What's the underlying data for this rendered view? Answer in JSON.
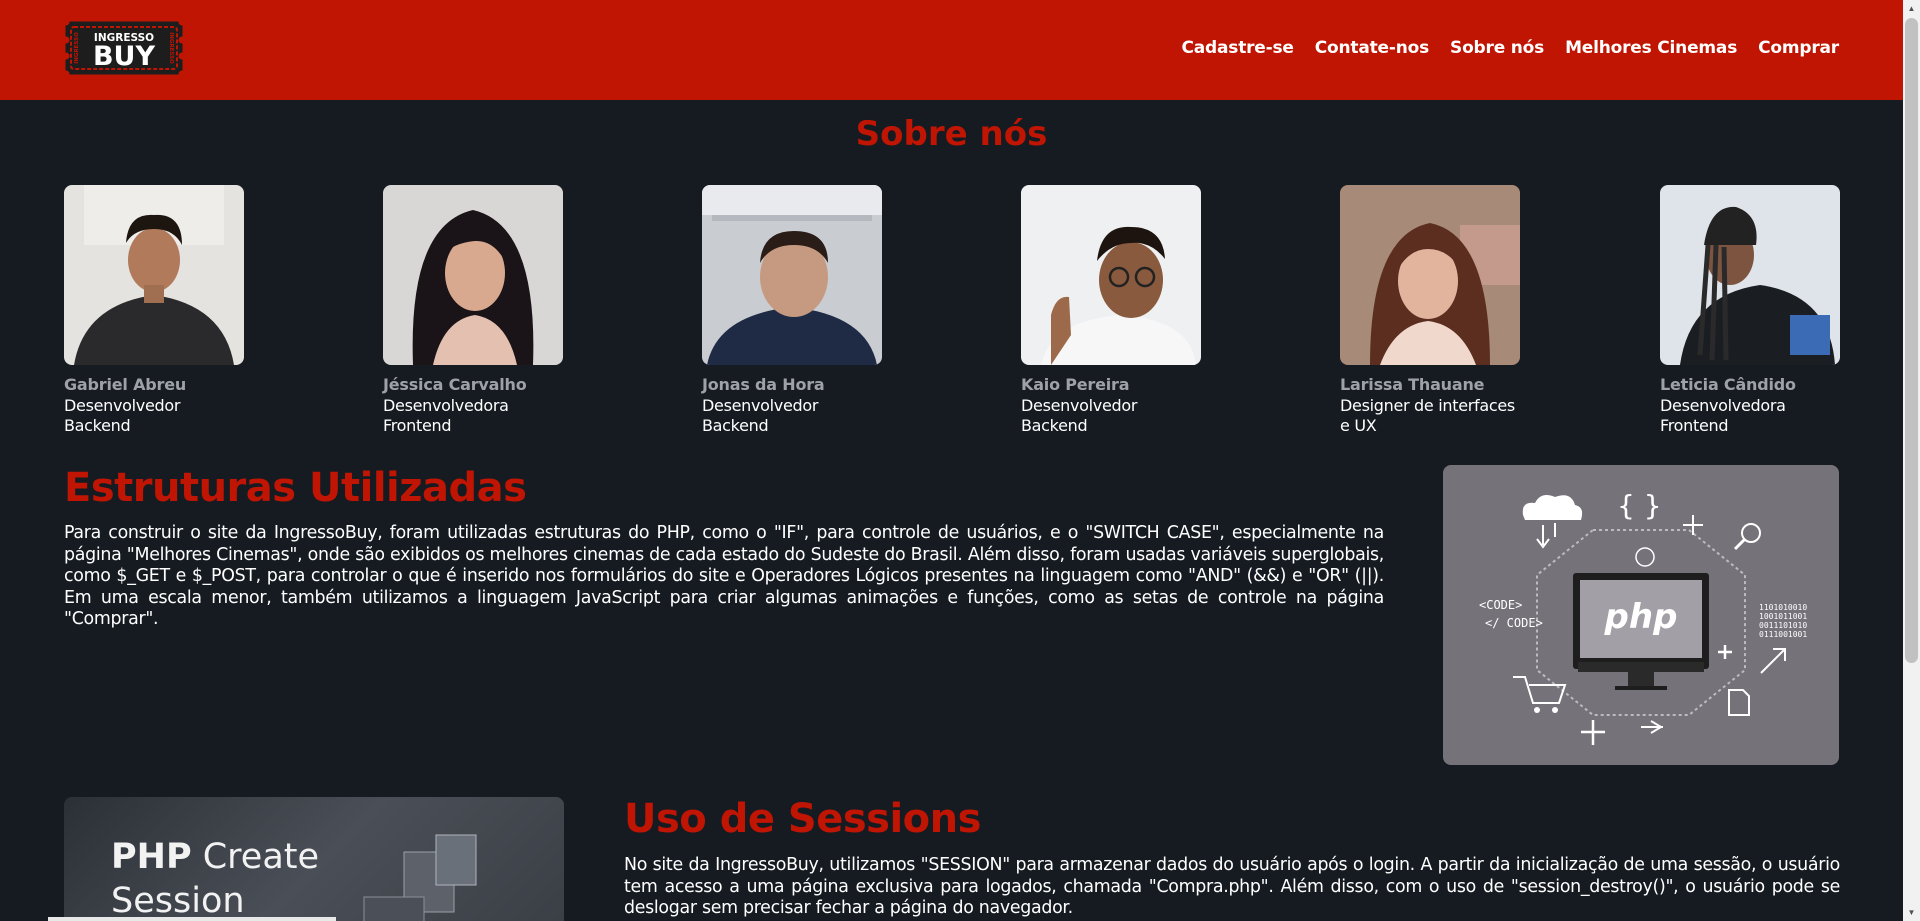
{
  "header": {
    "logo": {
      "top_text": "INGRESSO",
      "main_text": "BUY",
      "side_text": "INGRESSO"
    },
    "nav": [
      {
        "label": "Cadastre-se"
      },
      {
        "label": "Contate-nos"
      },
      {
        "label": "Sobre nós"
      },
      {
        "label": "Melhores Cinemas"
      },
      {
        "label": "Comprar"
      }
    ]
  },
  "about": {
    "title": "Sobre nós",
    "members": [
      {
        "name": "Gabriel Abreu",
        "role_line1": "Desenvolvedor",
        "role_line2": "Backend"
      },
      {
        "name": "Jéssica Carvalho",
        "role_line1": "Desenvolvedora",
        "role_line2": "Frontend"
      },
      {
        "name": "Jonas da Hora",
        "role_line1": "Desenvolvedor",
        "role_line2": "Backend"
      },
      {
        "name": "Kaio Pereira",
        "role_line1": "Desenvolvedor",
        "role_line2": "Backend"
      },
      {
        "name": "Larissa Thauane",
        "role_line1": "Designer de interfaces",
        "role_line2": "e UX"
      },
      {
        "name": "Leticia Cândido",
        "role_line1": "Desenvolvedora",
        "role_line2": "Frontend"
      }
    ]
  },
  "structures": {
    "title": "Estruturas Utilizadas",
    "paragraph": "Para construir o site da IngressoBuy, foram utilizadas estruturas do PHP, como o \"IF\", para controle de usuários, e o \"SWITCH CASE\", especialmente na página \"Melhores Cinemas\", onde são exibidos os melhores cinemas de cada estado do Sudeste do Brasil. Além disso, foram usadas variáveis superglobais, como $_GET e $_POST, para controlar o que é inserido nos formulários do site e Operadores Lógicos presentes na linguagem como \"AND\" (&&) e \"OR\" (||). Em uma escala menor, também utilizamos a linguagem JavaScript para criar algumas animações e funções, como as setas de controle na página \"Comprar\".",
    "image": {
      "logo_text": "php",
      "code_open": "<CODE>",
      "code_close": "</ CODE>",
      "binary": [
        "1101010010",
        "1001011001",
        "0011101010",
        "0111001001"
      ]
    }
  },
  "sessions": {
    "title": "Uso de Sessions",
    "paragraph": "No site da IngressoBuy, utilizamos \"SESSION\" para armazenar dados do usuário após o login. A partir da inicialização de uma sessão, o usuário tem acesso a uma página exclusiva para logados, chamada \"Compra.php\". Além disso, com o uso de \"session_destroy()\", o usuário pode se deslogar sem precisar fechar a página do navegador.",
    "image": {
      "bold": "PHP",
      "rest": " Create",
      "line2": "Session"
    }
  },
  "colors": {
    "brand_red": "#c01503",
    "background": "#161b22"
  }
}
